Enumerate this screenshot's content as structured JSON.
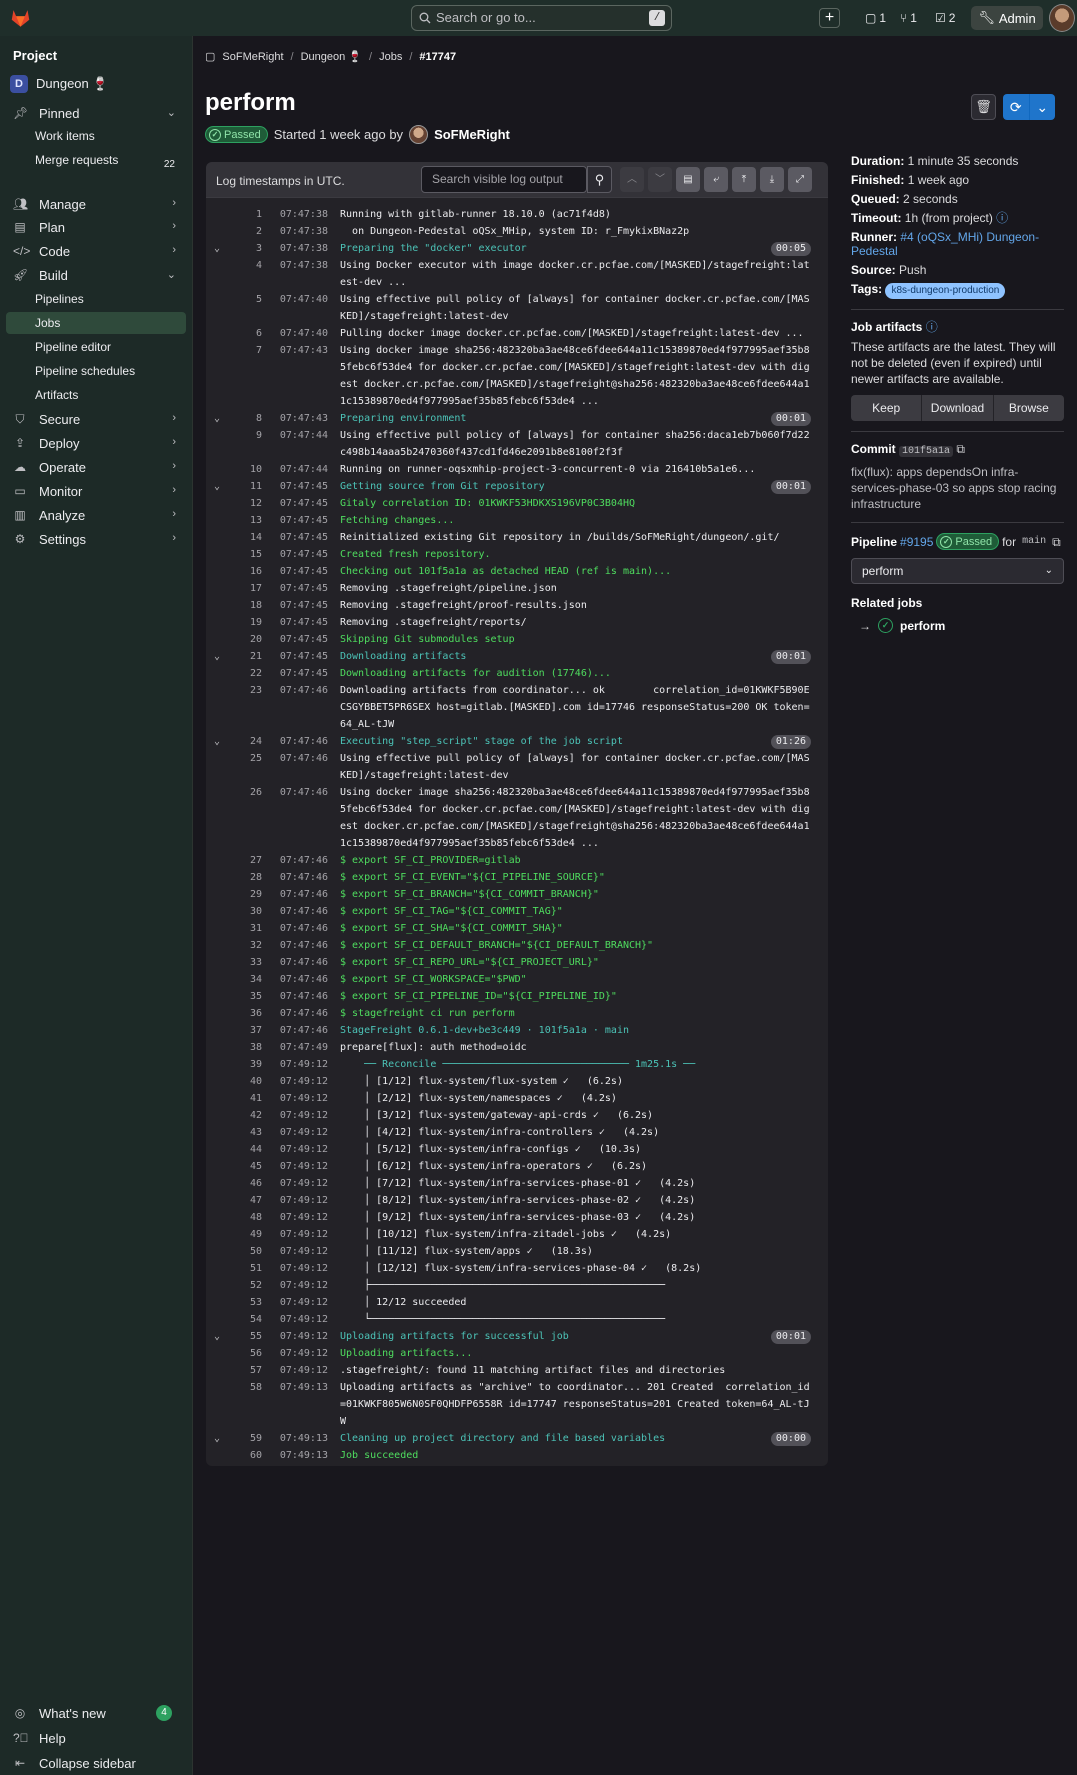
{
  "topbar": {
    "search_placeholder": "Search or go to...",
    "search_kbd": "/",
    "issues_count": "1",
    "mrs_count": "1",
    "todos_count": "2",
    "admin_label": "Admin"
  },
  "sidebar": {
    "heading": "Project",
    "project_initial": "D",
    "project_name": "Dungeon 🍷",
    "pinned": "Pinned",
    "work_items": "Work items",
    "merge_requests": "Merge requests",
    "merge_requests_count": "22",
    "manage": "Manage",
    "plan": "Plan",
    "code": "Code",
    "build": "Build",
    "pipelines": "Pipelines",
    "jobs": "Jobs",
    "pipeline_editor": "Pipeline editor",
    "pipeline_schedules": "Pipeline schedules",
    "artifacts": "Artifacts",
    "secure": "Secure",
    "deploy": "Deploy",
    "operate": "Operate",
    "monitor": "Monitor",
    "analyze": "Analyze",
    "settings": "Settings",
    "whats_new": "What's new",
    "whats_new_count": "4",
    "help": "Help",
    "collapse": "Collapse sidebar"
  },
  "breadcrumb": {
    "owner": "SoFMeRight",
    "project": "Dungeon 🍷",
    "jobs": "Jobs",
    "job_id": "#17747"
  },
  "header": {
    "title": "perform",
    "status": "Passed",
    "started": "Started 1 week ago by",
    "author": "SoFMeRight"
  },
  "log": {
    "timestamps_note": "Log timestamps in UTC.",
    "search_placeholder": "Search visible log output",
    "lines": [
      {
        "n": "1",
        "ts": "07:47:38",
        "t": "Running with gitlab-runner 18.10.0 (ac71f4d8)"
      },
      {
        "n": "2",
        "ts": "07:47:38",
        "t": "  on Dungeon-Pedestal oQSx_MHip, system ID: r_FmykixBNaz2p"
      },
      {
        "n": "3",
        "ts": "07:47:38",
        "t": "Preparing the \"docker\" executor",
        "sec": true,
        "dur": "00:05"
      },
      {
        "n": "4",
        "ts": "07:47:38",
        "t": "Using Docker executor with image docker.cr.pcfae.com/[MASKED]/stagefreight:latest-dev ..."
      },
      {
        "n": "5",
        "ts": "07:47:40",
        "t": "Using effective pull policy of [always] for container docker.cr.pcfae.com/[MASKED]/stagefreight:latest-dev"
      },
      {
        "n": "6",
        "ts": "07:47:40",
        "t": "Pulling docker image docker.cr.pcfae.com/[MASKED]/stagefreight:latest-dev ..."
      },
      {
        "n": "7",
        "ts": "07:47:43",
        "t": "Using docker image sha256:482320ba3ae48ce6fdee644a11c15389870ed4f977995aef35b85febc6f53de4 for docker.cr.pcfae.com/[MASKED]/stagefreight:latest-dev with digest docker.cr.pcfae.com/[MASKED]/stagefreight@sha256:482320ba3ae48ce6fdee644a11c15389870ed4f977995aef35b85febc6f53de4 ..."
      },
      {
        "n": "8",
        "ts": "07:47:43",
        "t": "Preparing environment",
        "sec": true,
        "dur": "00:01"
      },
      {
        "n": "9",
        "ts": "07:47:44",
        "t": "Using effective pull policy of [always] for container sha256:daca1eb7b060f7d22c498b14aaa5b2470360f437cd1fd46e2091b8e8100f2f3f"
      },
      {
        "n": "10",
        "ts": "07:47:44",
        "t": "Running on runner-oqsxmhip-project-3-concurrent-0 via 216410b5a1e6..."
      },
      {
        "n": "11",
        "ts": "07:47:45",
        "t": "Getting source from Git repository",
        "sec": true,
        "dur": "00:01"
      },
      {
        "n": "12",
        "ts": "07:47:45",
        "t": "Gitaly correlation ID: 01KWKF53HDKXS196VP0C3B04HQ",
        "grn": true
      },
      {
        "n": "13",
        "ts": "07:47:45",
        "t": "Fetching changes...",
        "grn": true
      },
      {
        "n": "14",
        "ts": "07:47:45",
        "t": "Reinitialized existing Git repository in /builds/SoFMeRight/dungeon/.git/"
      },
      {
        "n": "15",
        "ts": "07:47:45",
        "t": "Created fresh repository.",
        "grn": true
      },
      {
        "n": "16",
        "ts": "07:47:45",
        "t": "Checking out 101f5a1a as detached HEAD (ref is main)...",
        "grn": true
      },
      {
        "n": "17",
        "ts": "07:47:45",
        "t": "Removing .stagefreight/pipeline.json"
      },
      {
        "n": "18",
        "ts": "07:47:45",
        "t": "Removing .stagefreight/proof-results.json"
      },
      {
        "n": "19",
        "ts": "07:47:45",
        "t": "Removing .stagefreight/reports/"
      },
      {
        "n": "20",
        "ts": "07:47:45",
        "t": "Skipping Git submodules setup",
        "grn": true
      },
      {
        "n": "21",
        "ts": "07:47:45",
        "t": "Downloading artifacts",
        "sec": true,
        "dur": "00:01"
      },
      {
        "n": "22",
        "ts": "07:47:45",
        "t": "Downloading artifacts for audition (17746)...",
        "grn": true
      },
      {
        "n": "23",
        "ts": "07:47:46",
        "t": "Downloading artifacts from coordinator... ok        correlation_id=01KWKF5B90ECSGYBBET5PR6SEX host=gitlab.[MASKED].com id=17746 responseStatus=200 OK token=64_AL-tJW"
      },
      {
        "n": "24",
        "ts": "07:47:46",
        "t": "Executing \"step_script\" stage of the job script",
        "sec": true,
        "dur": "01:26"
      },
      {
        "n": "25",
        "ts": "07:47:46",
        "t": "Using effective pull policy of [always] for container docker.cr.pcfae.com/[MASKED]/stagefreight:latest-dev"
      },
      {
        "n": "26",
        "ts": "07:47:46",
        "t": "Using docker image sha256:482320ba3ae48ce6fdee644a11c15389870ed4f977995aef35b85febc6f53de4 for docker.cr.pcfae.com/[MASKED]/stagefreight:latest-dev with digest docker.cr.pcfae.com/[MASKED]/stagefreight@sha256:482320ba3ae48ce6fdee644a11c15389870ed4f977995aef35b85febc6f53de4 ..."
      },
      {
        "n": "27",
        "ts": "07:47:46",
        "t": "$ export SF_CI_PROVIDER=gitlab",
        "grn": true
      },
      {
        "n": "28",
        "ts": "07:47:46",
        "t": "$ export SF_CI_EVENT=\"${CI_PIPELINE_SOURCE}\"",
        "grn": true
      },
      {
        "n": "29",
        "ts": "07:47:46",
        "t": "$ export SF_CI_BRANCH=\"${CI_COMMIT_BRANCH}\"",
        "grn": true
      },
      {
        "n": "30",
        "ts": "07:47:46",
        "t": "$ export SF_CI_TAG=\"${CI_COMMIT_TAG}\"",
        "grn": true
      },
      {
        "n": "31",
        "ts": "07:47:46",
        "t": "$ export SF_CI_SHA=\"${CI_COMMIT_SHA}\"",
        "grn": true
      },
      {
        "n": "32",
        "ts": "07:47:46",
        "t": "$ export SF_CI_DEFAULT_BRANCH=\"${CI_DEFAULT_BRANCH}\"",
        "grn": true
      },
      {
        "n": "33",
        "ts": "07:47:46",
        "t": "$ export SF_CI_REPO_URL=\"${CI_PROJECT_URL}\"",
        "grn": true
      },
      {
        "n": "34",
        "ts": "07:47:46",
        "t": "$ export SF_CI_WORKSPACE=\"$PWD\"",
        "grn": true
      },
      {
        "n": "35",
        "ts": "07:47:46",
        "t": "$ export SF_CI_PIPELINE_ID=\"${CI_PIPELINE_ID}\"",
        "grn": true
      },
      {
        "n": "36",
        "ts": "07:47:46",
        "t": "$ stagefreight ci run perform",
        "grn": true
      },
      {
        "n": "37",
        "ts": "07:47:46",
        "t": "StageFreight 0.6.1-dev+be3c449 · 101f5a1a · main",
        "sec": true
      },
      {
        "n": "38",
        "ts": "07:47:49",
        "t": "prepare[flux]: auth method=oidc"
      },
      {
        "n": "39",
        "ts": "07:49:12",
        "t": "    ── Reconcile ─────────────────────────────── 1m25.1s ──",
        "sec": true
      },
      {
        "n": "40",
        "ts": "07:49:12",
        "t": "    │ [1/12] flux-system/flux-system ✓   (6.2s)"
      },
      {
        "n": "41",
        "ts": "07:49:12",
        "t": "    │ [2/12] flux-system/namespaces ✓   (4.2s)"
      },
      {
        "n": "42",
        "ts": "07:49:12",
        "t": "    │ [3/12] flux-system/gateway-api-crds ✓   (6.2s)"
      },
      {
        "n": "43",
        "ts": "07:49:12",
        "t": "    │ [4/12] flux-system/infra-controllers ✓   (4.2s)"
      },
      {
        "n": "44",
        "ts": "07:49:12",
        "t": "    │ [5/12] flux-system/infra-configs ✓   (10.3s)"
      },
      {
        "n": "45",
        "ts": "07:49:12",
        "t": "    │ [6/12] flux-system/infra-operators ✓   (6.2s)"
      },
      {
        "n": "46",
        "ts": "07:49:12",
        "t": "    │ [7/12] flux-system/infra-services-phase-01 ✓   (4.2s)"
      },
      {
        "n": "47",
        "ts": "07:49:12",
        "t": "    │ [8/12] flux-system/infra-services-phase-02 ✓   (4.2s)"
      },
      {
        "n": "48",
        "ts": "07:49:12",
        "t": "    │ [9/12] flux-system/infra-services-phase-03 ✓   (4.2s)"
      },
      {
        "n": "49",
        "ts": "07:49:12",
        "t": "    │ [10/12] flux-system/infra-zitadel-jobs ✓   (4.2s)"
      },
      {
        "n": "50",
        "ts": "07:49:12",
        "t": "    │ [11/12] flux-system/apps ✓   (18.3s)"
      },
      {
        "n": "51",
        "ts": "07:49:12",
        "t": "    │ [12/12] flux-system/infra-services-phase-04 ✓   (8.2s)"
      },
      {
        "n": "52",
        "ts": "07:49:12",
        "t": "    ├─────────────────────────────────────────────────"
      },
      {
        "n": "53",
        "ts": "07:49:12",
        "t": "    │ 12/12 succeeded"
      },
      {
        "n": "54",
        "ts": "07:49:12",
        "t": "    └─────────────────────────────────────────────────"
      },
      {
        "n": "55",
        "ts": "07:49:12",
        "t": "Uploading artifacts for successful job",
        "sec": true,
        "dur": "00:01"
      },
      {
        "n": "56",
        "ts": "07:49:12",
        "t": "Uploading artifacts...",
        "grn": true
      },
      {
        "n": "57",
        "ts": "07:49:12",
        "t": ".stagefreight/: found 11 matching artifact files and directories"
      },
      {
        "n": "58",
        "ts": "07:49:13",
        "t": "Uploading artifacts as \"archive\" to coordinator... 201 Created  correlation_id=01KWKF805W6N0SF0QHDFP6558R id=17747 responseStatus=201 Created token=64_AL-tJW"
      },
      {
        "n": "59",
        "ts": "07:49:13",
        "t": "Cleaning up project directory and file based variables",
        "sec": true,
        "dur": "00:00"
      },
      {
        "n": "60",
        "ts": "07:49:13",
        "t": "Job succeeded",
        "grn": true
      }
    ]
  },
  "details": {
    "duration_label": "Duration:",
    "duration": "1 minute 35 seconds",
    "finished_label": "Finished:",
    "finished": "1 week ago",
    "queued_label": "Queued:",
    "queued": "2 seconds",
    "timeout_label": "Timeout:",
    "timeout": "1h (from project)",
    "runner_label": "Runner:",
    "runner": "#4 (oQSx_MHi) Dungeon-Pedestal",
    "source_label": "Source:",
    "source": "Push",
    "tags_label": "Tags:",
    "tag": "k8s-dungeon-production",
    "artifacts_title": "Job artifacts",
    "artifacts_note": "These artifacts are the latest. They will not be deleted (even if expired) until newer artifacts are available.",
    "keep": "Keep",
    "download": "Download",
    "browse": "Browse",
    "commit_label": "Commit",
    "commit_sha": "101f5a1a",
    "commit_msg": "fix(flux): apps dependsOn infra-services-phase-03 so apps stop racing infrastructure",
    "pipeline_label": "Pipeline",
    "pipeline_id": "#9195",
    "pipeline_status": "Passed",
    "for": "for",
    "branch": "main",
    "stage": "perform",
    "related_title": "Related jobs",
    "related_job": "perform"
  }
}
